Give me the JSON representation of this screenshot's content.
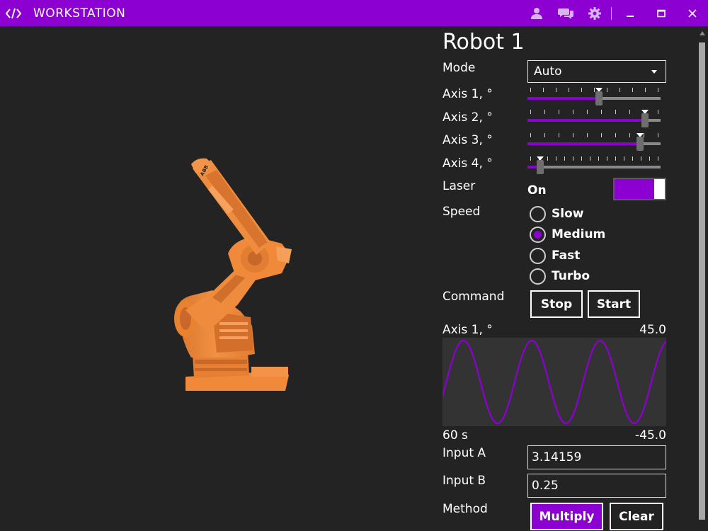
{
  "window": {
    "title": "WORKSTATION",
    "accent_color": "#8c00d2",
    "icons": [
      "code-icon",
      "user-icon",
      "chat-icon",
      "gear-icon",
      "minimize-icon",
      "maximize-icon",
      "close-icon"
    ]
  },
  "panel": {
    "title": "Robot 1",
    "mode": {
      "label": "Mode",
      "value": "Auto"
    },
    "axes": [
      {
        "label": "Axis 1, °",
        "value": 0.55,
        "ticks": 11
      },
      {
        "label": "Axis 2, °",
        "value": 0.92,
        "ticks": 10
      },
      {
        "label": "Axis 3, °",
        "value": 0.88,
        "ticks": 10
      },
      {
        "label": "Axis 4, °",
        "value": 0.08,
        "ticks": 16
      }
    ],
    "laser": {
      "label": "Laser",
      "state": "On",
      "on": true
    },
    "speed": {
      "label": "Speed",
      "options": [
        "Slow",
        "Medium",
        "Fast",
        "Turbo"
      ],
      "selected": "Medium"
    },
    "command": {
      "label": "Command",
      "stop_label": "Stop",
      "start_label": "Start"
    },
    "chart_labels": {
      "series": "Axis 1, °",
      "max": "45.0",
      "min": "-45.0",
      "duration": "60 s"
    },
    "input_a": {
      "label": "Input A",
      "value": "3.14159"
    },
    "input_b": {
      "label": "Input B",
      "value": "0.25"
    },
    "method": {
      "label": "Method",
      "multiply_label": "Multiply",
      "clear_label": "Clear"
    }
  },
  "chart_data": {
    "type": "line",
    "series": [
      {
        "name": "Axis 1, °",
        "period": 55,
        "amplitude": 45,
        "phase_deg": -20
      }
    ],
    "xlabel": "60 s",
    "ylim": [
      -45.0,
      45.0
    ],
    "xlim": [
      0,
      60
    ],
    "line_color": "#8c00d2",
    "grid": false
  }
}
